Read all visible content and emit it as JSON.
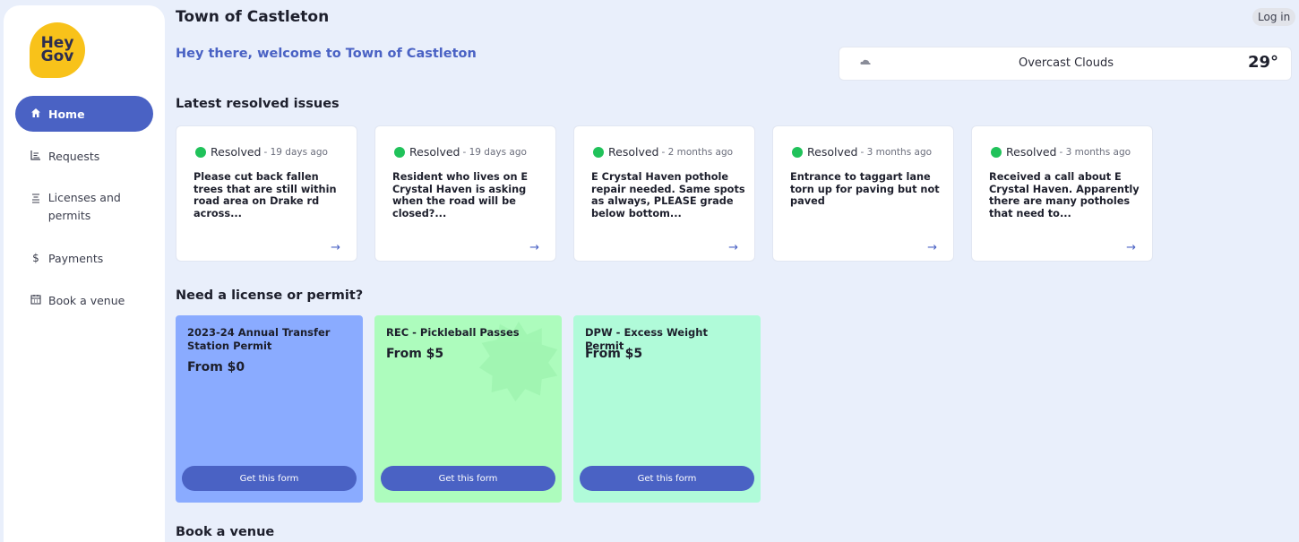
{
  "app": {
    "logo_line1": "Hey",
    "logo_line2": "Gov",
    "town_title": "Town of Castleton",
    "login_label": "Log in",
    "welcome": "Hey there, welcome to Town of Castleton"
  },
  "sidebar": {
    "items": [
      {
        "label": "Home",
        "icon": "home-icon",
        "active": true
      },
      {
        "label": "Requests",
        "icon": "requests-icon"
      },
      {
        "label": "Licenses and permits",
        "icon": "licenses-icon"
      },
      {
        "label": "Payments",
        "icon": "dollar-icon"
      },
      {
        "label": "Book a venue",
        "icon": "calendar-icon"
      }
    ]
  },
  "weather": {
    "description": "Overcast Clouds",
    "temperature": "29°",
    "icon": "cloud-icon"
  },
  "sections": {
    "issues_title": "Latest resolved issues",
    "permits_title": "Need a license or permit?",
    "venue_title": "Book a venue"
  },
  "issues": [
    {
      "status": "Resolved",
      "ago": "- 19 days ago",
      "text": "Please cut back fallen trees that are still within road area on Drake rd across..."
    },
    {
      "status": "Resolved",
      "ago": "- 19 days ago",
      "text": "Resident who lives on E Crystal Haven is asking when the road will be closed?..."
    },
    {
      "status": "Resolved",
      "ago": "- 2 months ago",
      "text": "E Crystal Haven pothole repair needed. Same spots as always, PLEASE grade below bottom..."
    },
    {
      "status": "Resolved",
      "ago": "- 3 months ago",
      "text": "Entrance to taggart lane torn up for paving but not paved"
    },
    {
      "status": "Resolved",
      "ago": "- 3 months ago",
      "text": "Received a call about E Crystal Haven. Apparently there are many potholes that need to..."
    }
  ],
  "permits": [
    {
      "name": "2023-24 Annual Transfer Station Permit",
      "price": "From $0",
      "button": "Get this form",
      "color": "#8aabff"
    },
    {
      "name": "REC - Pickleball Passes",
      "price": "From $5",
      "button": "Get this form",
      "color": "#adfcbd"
    },
    {
      "name": "DPW - Excess Weight Permit",
      "price": "From $5",
      "button": "Get this form",
      "color": "#b0fbd9"
    }
  ],
  "colors": {
    "accent": "#4a62c4",
    "background": "#e9effb",
    "resolved": "#20c25a",
    "logo": "#f8c21a"
  }
}
